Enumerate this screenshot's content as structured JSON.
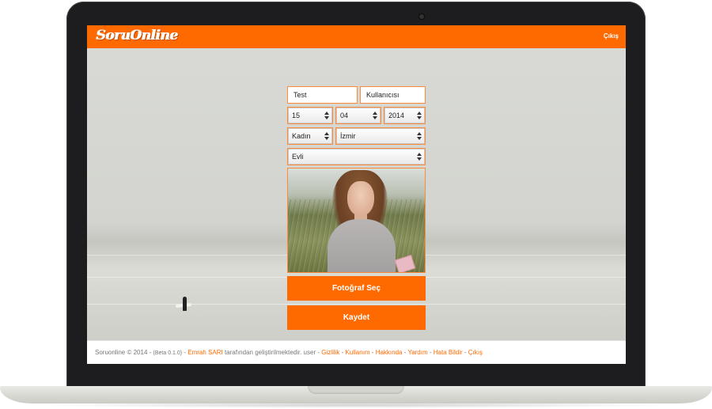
{
  "app": {
    "logo_text": "SoruOnline",
    "brand_color": "#ff6a00",
    "logout_top": "Çıkış"
  },
  "form": {
    "first_name": "Test",
    "last_name": "Kullanıcısı",
    "birth_day": "15",
    "birth_month": "04",
    "birth_year": "2014",
    "gender": "Kadın",
    "city": "İzmir",
    "marital_status": "Evli",
    "select_photo_button": "Fotoğraf Seç",
    "save_button": "Kaydet"
  },
  "footer": {
    "copyright": "Soruonline © 2014 -",
    "beta": "(Beta 0.1.0)",
    "dash": "-",
    "author_link": "Emrah SARI",
    "developed_by": "tarafından geliştirilmektedir. user -",
    "links": [
      "Gizlilik",
      "Kullanım",
      "Hakkında",
      "Yardım",
      "Hata Bildir",
      "Çıkış"
    ],
    "separator": " - "
  },
  "icons": {
    "select_arrows": "updown-arrows-icon",
    "photo": "profile-photo"
  }
}
